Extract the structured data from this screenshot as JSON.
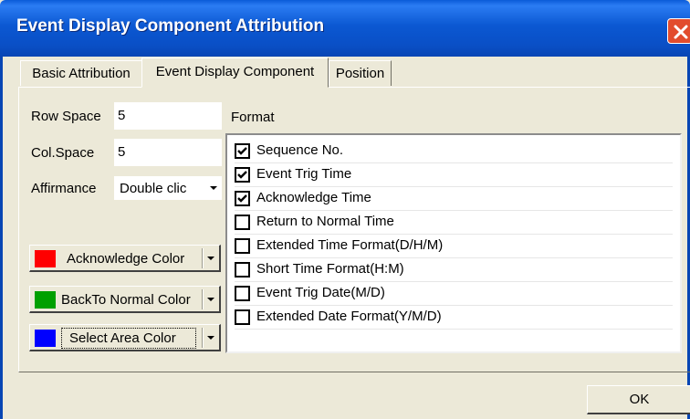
{
  "window": {
    "title": "Event Display Component Attribution"
  },
  "tabs": [
    {
      "label": "Basic Attribution"
    },
    {
      "label": "Event Display Component"
    },
    {
      "label": "Position"
    }
  ],
  "form": {
    "row_space_label": "Row Space",
    "row_space_value": "5",
    "col_space_label": "Col.Space",
    "col_space_value": "5",
    "affirmance_label": "Affirmance",
    "affirmance_value": "Double clic",
    "format_label": "Format"
  },
  "color_buttons": [
    {
      "label": "Acknowledge Color",
      "color": "#ff0000"
    },
    {
      "label": "BackTo Normal Color",
      "color": "#00a000"
    },
    {
      "label": "Select Area Color",
      "color": "#0000ff"
    }
  ],
  "format_items": [
    {
      "label": "Sequence No.",
      "checked": true
    },
    {
      "label": "Event Trig Time",
      "checked": true
    },
    {
      "label": "Acknowledge Time",
      "checked": true
    },
    {
      "label": "Return to Normal Time",
      "checked": false
    },
    {
      "label": "Extended Time Format(D/H/M)",
      "checked": false
    },
    {
      "label": "Short Time Format(H:M)",
      "checked": false
    },
    {
      "label": "Event Trig Date(M/D)",
      "checked": false
    },
    {
      "label": "Extended Date Format(Y/M/D)",
      "checked": false
    }
  ],
  "buttons": {
    "ok": "OK"
  },
  "icons": {
    "close": "close-icon",
    "dropdown": "chevron-down-icon",
    "check": "check-icon"
  }
}
